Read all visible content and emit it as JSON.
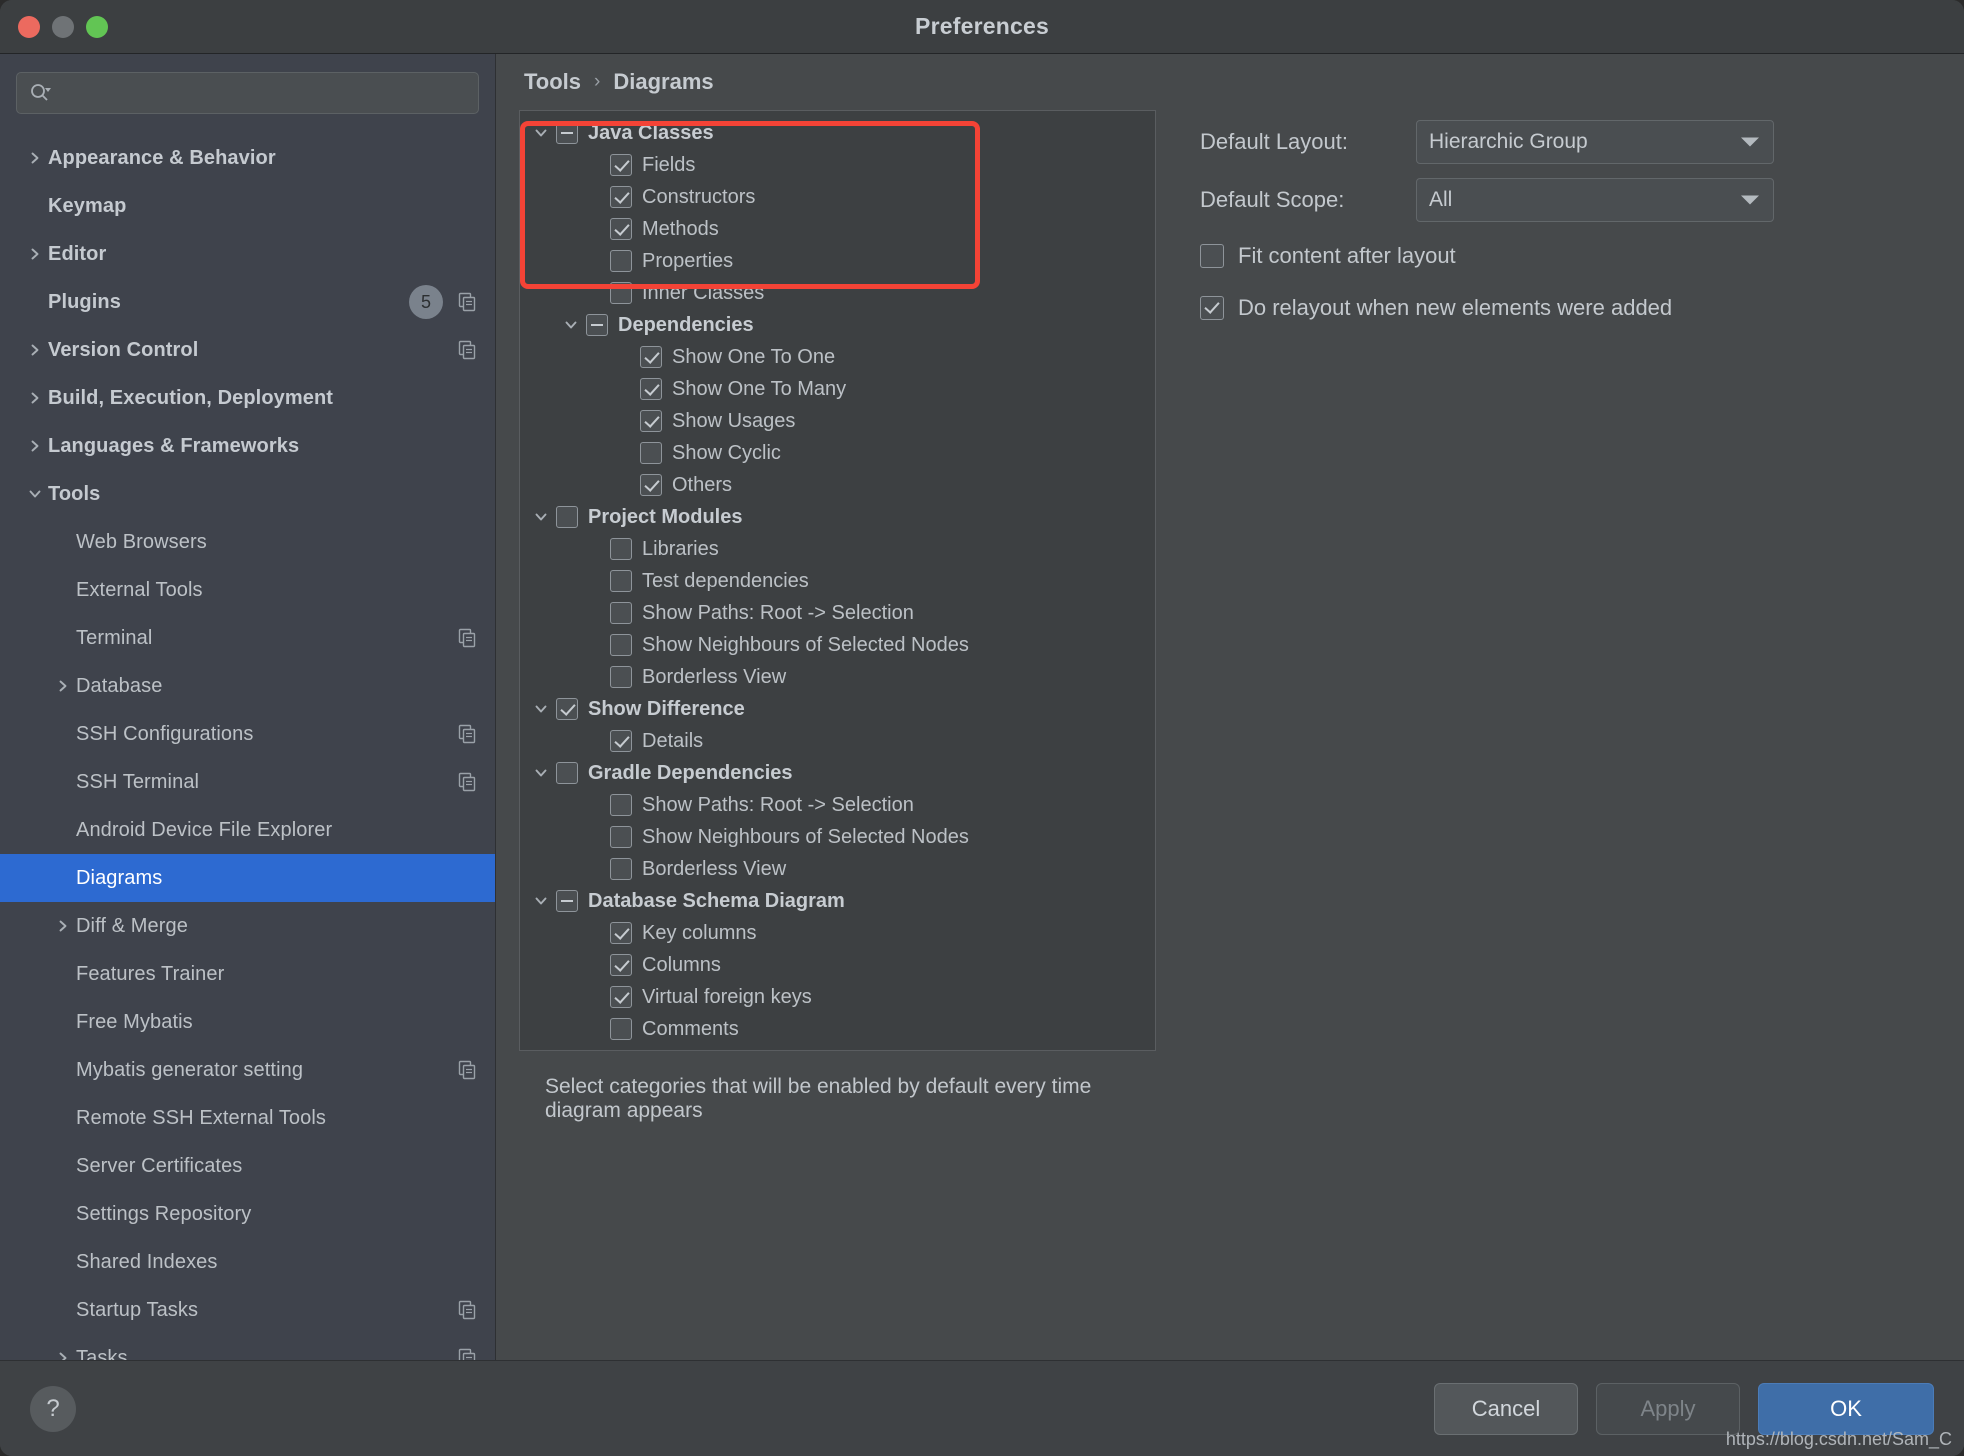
{
  "window": {
    "title": "Preferences",
    "traffic_lights": [
      "close-red",
      "minimize-gray",
      "zoom-green"
    ]
  },
  "search": {
    "value": "",
    "placeholder": "",
    "icon": "search-icon"
  },
  "sidebar": {
    "items": [
      {
        "label": "Appearance & Behavior",
        "arrow": "right",
        "bold": true,
        "indent": 0
      },
      {
        "label": "Keymap",
        "arrow": "none",
        "bold": true,
        "indent": 0
      },
      {
        "label": "Editor",
        "arrow": "right",
        "bold": true,
        "indent": 0
      },
      {
        "label": "Plugins",
        "arrow": "none",
        "bold": true,
        "indent": 0,
        "badge": "5",
        "copy": true
      },
      {
        "label": "Version Control",
        "arrow": "right",
        "bold": true,
        "indent": 0,
        "copy": true
      },
      {
        "label": "Build, Execution, Deployment",
        "arrow": "right",
        "bold": true,
        "indent": 0
      },
      {
        "label": "Languages & Frameworks",
        "arrow": "right",
        "bold": true,
        "indent": 0
      },
      {
        "label": "Tools",
        "arrow": "down",
        "bold": true,
        "indent": 0
      },
      {
        "label": "Web Browsers",
        "arrow": "none",
        "bold": false,
        "indent": 1
      },
      {
        "label": "External Tools",
        "arrow": "none",
        "bold": false,
        "indent": 1
      },
      {
        "label": "Terminal",
        "arrow": "none",
        "bold": false,
        "indent": 1,
        "copy": true
      },
      {
        "label": "Database",
        "arrow": "right",
        "bold": false,
        "indent": 1
      },
      {
        "label": "SSH Configurations",
        "arrow": "none",
        "bold": false,
        "indent": 1,
        "copy": true
      },
      {
        "label": "SSH Terminal",
        "arrow": "none",
        "bold": false,
        "indent": 1,
        "copy": true
      },
      {
        "label": "Android Device File Explorer",
        "arrow": "none",
        "bold": false,
        "indent": 1
      },
      {
        "label": "Diagrams",
        "arrow": "none",
        "bold": false,
        "indent": 1,
        "selected": true
      },
      {
        "label": "Diff & Merge",
        "arrow": "right",
        "bold": false,
        "indent": 1
      },
      {
        "label": "Features Trainer",
        "arrow": "none",
        "bold": false,
        "indent": 1
      },
      {
        "label": "Free Mybatis",
        "arrow": "none",
        "bold": false,
        "indent": 1
      },
      {
        "label": "Mybatis generator setting",
        "arrow": "none",
        "bold": false,
        "indent": 1,
        "copy": true
      },
      {
        "label": "Remote SSH External Tools",
        "arrow": "none",
        "bold": false,
        "indent": 1
      },
      {
        "label": "Server Certificates",
        "arrow": "none",
        "bold": false,
        "indent": 1
      },
      {
        "label": "Settings Repository",
        "arrow": "none",
        "bold": false,
        "indent": 1
      },
      {
        "label": "Shared Indexes",
        "arrow": "none",
        "bold": false,
        "indent": 1
      },
      {
        "label": "Startup Tasks",
        "arrow": "none",
        "bold": false,
        "indent": 1,
        "copy": true
      },
      {
        "label": "Tasks",
        "arrow": "right",
        "bold": false,
        "indent": 1,
        "copy": true
      }
    ]
  },
  "breadcrumb": {
    "root": "Tools",
    "separator": "›",
    "current": "Diagrams"
  },
  "tree": {
    "nodes": [
      {
        "label": "Java Classes",
        "state": "partial",
        "twisty": "down",
        "indent": 0,
        "bold": true,
        "highlighted": true
      },
      {
        "label": "Fields",
        "state": "checked",
        "twisty": "none",
        "indent": 1,
        "bold": false,
        "highlighted": true
      },
      {
        "label": "Constructors",
        "state": "checked",
        "twisty": "none",
        "indent": 1,
        "bold": false,
        "highlighted": true
      },
      {
        "label": "Methods",
        "state": "checked",
        "twisty": "none",
        "indent": 1,
        "bold": false,
        "highlighted": true
      },
      {
        "label": "Properties",
        "state": "unchecked",
        "twisty": "none",
        "indent": 1,
        "bold": false
      },
      {
        "label": "Inner Classes",
        "state": "unchecked",
        "twisty": "none",
        "indent": 1,
        "bold": false
      },
      {
        "label": "Dependencies",
        "state": "partial",
        "twisty": "down",
        "indent": 2,
        "bold": true
      },
      {
        "label": "Show One To One",
        "state": "checked",
        "twisty": "none",
        "indent": 3,
        "bold": false
      },
      {
        "label": "Show One To Many",
        "state": "checked",
        "twisty": "none",
        "indent": 3,
        "bold": false
      },
      {
        "label": "Show Usages",
        "state": "checked",
        "twisty": "none",
        "indent": 3,
        "bold": false
      },
      {
        "label": "Show Cyclic",
        "state": "unchecked",
        "twisty": "none",
        "indent": 3,
        "bold": false
      },
      {
        "label": "Others",
        "state": "checked",
        "twisty": "none",
        "indent": 3,
        "bold": false
      },
      {
        "label": "Project Modules",
        "state": "unchecked",
        "twisty": "down",
        "indent": 0,
        "bold": true
      },
      {
        "label": "Libraries",
        "state": "unchecked",
        "twisty": "none",
        "indent": 1,
        "bold": false
      },
      {
        "label": "Test dependencies",
        "state": "unchecked",
        "twisty": "none",
        "indent": 1,
        "bold": false
      },
      {
        "label": "Show Paths: Root -> Selection",
        "state": "unchecked",
        "twisty": "none",
        "indent": 1,
        "bold": false
      },
      {
        "label": "Show Neighbours of Selected Nodes",
        "state": "unchecked",
        "twisty": "none",
        "indent": 1,
        "bold": false
      },
      {
        "label": "Borderless View",
        "state": "unchecked",
        "twisty": "none",
        "indent": 1,
        "bold": false
      },
      {
        "label": "Show Difference",
        "state": "checked",
        "twisty": "down",
        "indent": 0,
        "bold": true
      },
      {
        "label": "Details",
        "state": "checked",
        "twisty": "none",
        "indent": 1,
        "bold": false
      },
      {
        "label": "Gradle Dependencies",
        "state": "unchecked",
        "twisty": "down",
        "indent": 0,
        "bold": true
      },
      {
        "label": "Show Paths: Root -> Selection",
        "state": "unchecked",
        "twisty": "none",
        "indent": 1,
        "bold": false
      },
      {
        "label": "Show Neighbours of Selected Nodes",
        "state": "unchecked",
        "twisty": "none",
        "indent": 1,
        "bold": false
      },
      {
        "label": "Borderless View",
        "state": "unchecked",
        "twisty": "none",
        "indent": 1,
        "bold": false
      },
      {
        "label": "Database Schema Diagram",
        "state": "partial",
        "twisty": "down",
        "indent": 0,
        "bold": true
      },
      {
        "label": "Key columns",
        "state": "checked",
        "twisty": "none",
        "indent": 1,
        "bold": false
      },
      {
        "label": "Columns",
        "state": "checked",
        "twisty": "none",
        "indent": 1,
        "bold": false
      },
      {
        "label": "Virtual foreign keys",
        "state": "checked",
        "twisty": "none",
        "indent": 1,
        "bold": false
      },
      {
        "label": "Comments",
        "state": "unchecked",
        "twisty": "none",
        "indent": 1,
        "bold": false
      }
    ],
    "hint": "Select categories that will be enabled by default every time diagram appears",
    "highlight_color": "#f44336"
  },
  "options": {
    "default_layout": {
      "label": "Default Layout:",
      "value": "Hierarchic Group"
    },
    "default_scope": {
      "label": "Default Scope:",
      "value": "All"
    },
    "fit_content": {
      "label": "Fit content after layout",
      "checked": false
    },
    "do_relayout": {
      "label": "Do relayout when new elements were added",
      "checked": true
    }
  },
  "footer": {
    "help": "?",
    "cancel": "Cancel",
    "apply": "Apply",
    "ok": "OK",
    "watermark": "https://blog.csdn.net/Sam_C",
    "accent": "#3f6ea8"
  }
}
